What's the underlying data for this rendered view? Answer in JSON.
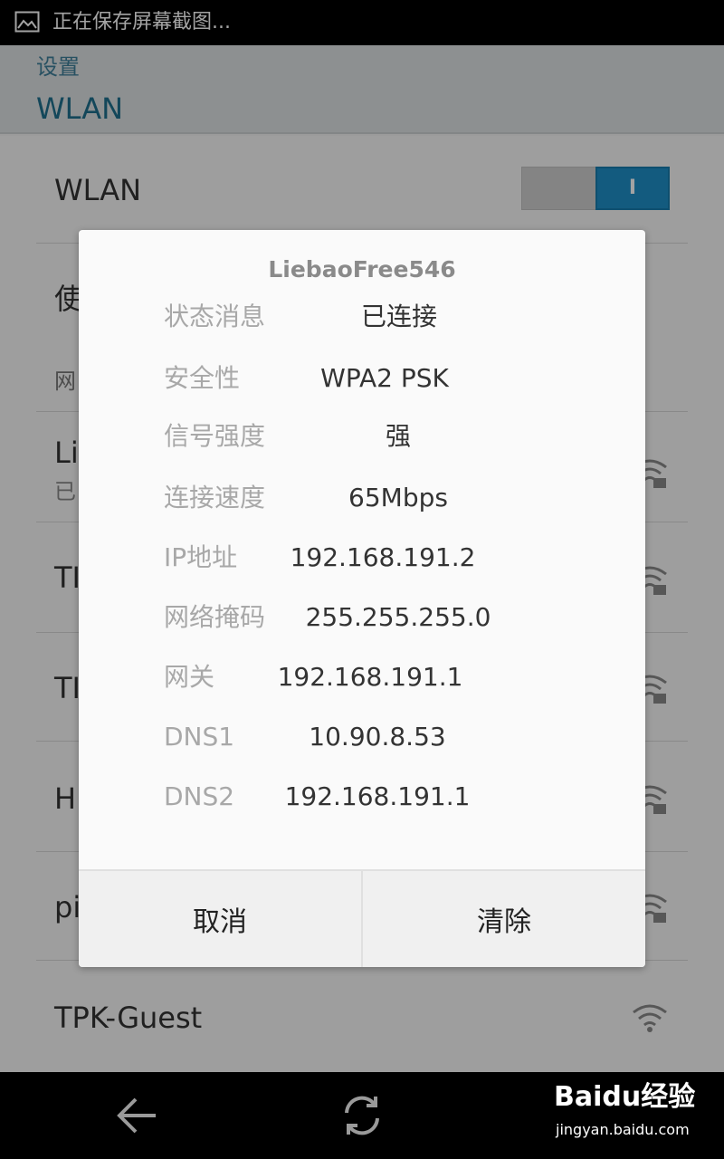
{
  "status_bar": {
    "icon": "image-icon",
    "text": "正在保存屏幕截图..."
  },
  "header": {
    "parent": "设置",
    "title": "WLAN"
  },
  "wlan_toggle": {
    "label": "WLAN",
    "state": "I",
    "accent": "#1f8fc7"
  },
  "background_rows": [
    {
      "label": "使"
    },
    {
      "label": "网"
    },
    {
      "label": "Li",
      "sub": "已"
    },
    {
      "label": "TI"
    },
    {
      "label": "TI"
    },
    {
      "label": "H"
    },
    {
      "label": "pi"
    },
    {
      "label": "TPK-Guest"
    }
  ],
  "dialog": {
    "title": "LiebaoFree546",
    "rows": [
      {
        "label": "状态消息",
        "value": "已连接"
      },
      {
        "label": "安全性",
        "value": "WPA2 PSK"
      },
      {
        "label": "信号强度",
        "value": "强"
      },
      {
        "label": "连接速度",
        "value": "65Mbps"
      },
      {
        "label": "IP地址",
        "value": "192.168.191.2"
      },
      {
        "label": "网络掩码",
        "value": "255.255.255.0"
      },
      {
        "label": "网关",
        "value": "192.168.191.1"
      },
      {
        "label": "DNS1",
        "value": "10.90.8.53"
      },
      {
        "label": "DNS2",
        "value": "192.168.191.1"
      }
    ],
    "cancel_label": "取消",
    "forget_label": "清除"
  },
  "nav_bar": {
    "back": "back-arrow-icon",
    "refresh": "refresh-icon"
  },
  "watermark": {
    "logo": "Baidu经验",
    "url": "jingyan.baidu.com"
  }
}
